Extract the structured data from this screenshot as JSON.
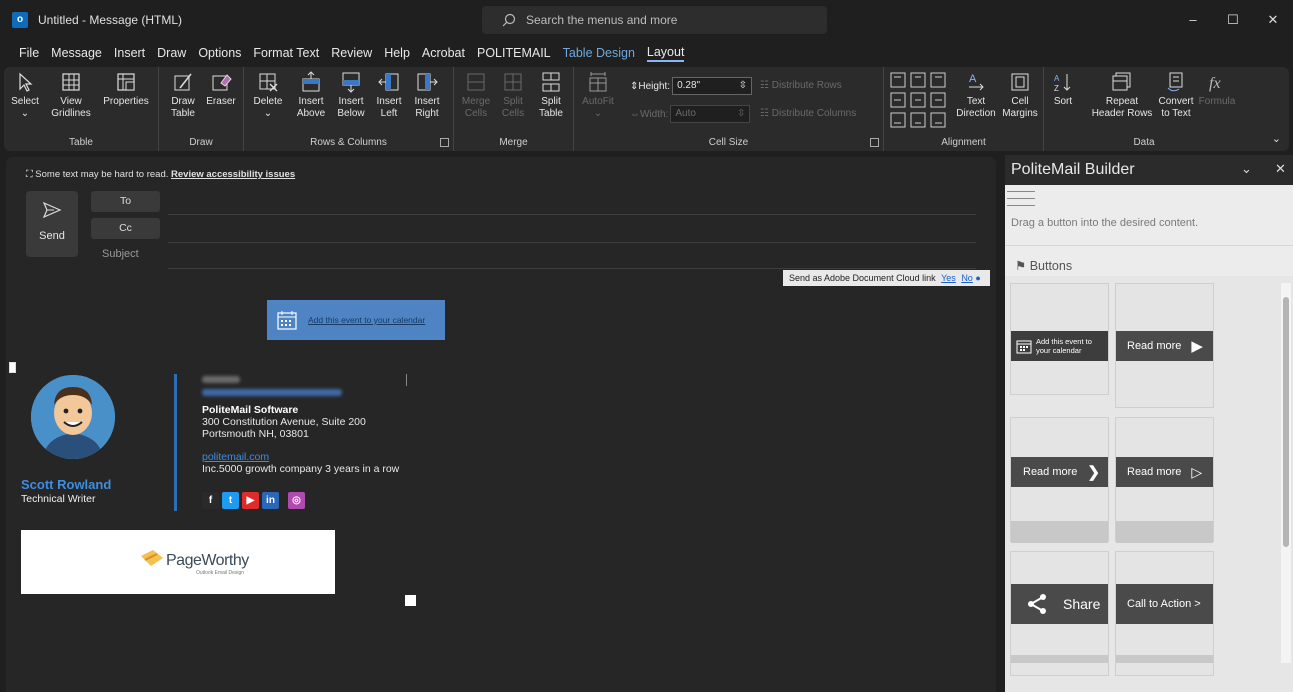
{
  "window": {
    "title": "Untitled  -  Message (HTML)",
    "search_placeholder": "Search the menus and more",
    "controls": [
      "–",
      "☐",
      "✕"
    ]
  },
  "menu": [
    "File",
    "Message",
    "Insert",
    "Draw",
    "Options",
    "Format Text",
    "Review",
    "Help",
    "Acrobat",
    "POLITEMAIL",
    "Table Design",
    "Layout"
  ],
  "ribbon": {
    "table": {
      "label": "Table",
      "select": "Select",
      "select_arrow": "⌄",
      "view_gridlines_1": "View",
      "view_gridlines_2": "Gridlines",
      "properties": "Properties"
    },
    "draw": {
      "label": "Draw",
      "draw_table_1": "Draw",
      "draw_table_2": "Table",
      "eraser": "Eraser"
    },
    "rows": {
      "label": "Rows & Columns",
      "delete": "Delete",
      "delete_arrow": "⌄",
      "insert_above_1": "Insert",
      "insert_above_2": "Above",
      "insert_below_1": "Insert",
      "insert_below_2": "Below",
      "insert_left_1": "Insert",
      "insert_left_2": "Left",
      "insert_right_1": "Insert",
      "insert_right_2": "Right"
    },
    "merge": {
      "label": "Merge",
      "merge_cells_1": "Merge",
      "merge_cells_2": "Cells",
      "split_cells_1": "Split",
      "split_cells_2": "Cells",
      "split_table_1": "Split",
      "split_table_2": "Table"
    },
    "cellsize": {
      "label": "Cell Size",
      "autofit": "AutoFit",
      "autofit_arrow": "⌄",
      "height_label": "Height:",
      "height_value": "0.28\"",
      "width_label": "Width:",
      "width_value": "Auto",
      "distribute_rows": "Distribute Rows",
      "distribute_columns": "Distribute Columns"
    },
    "alignment": {
      "label": "Alignment",
      "text_direction_1": "Text",
      "text_direction_2": "Direction",
      "cell_margins_1": "Cell",
      "cell_margins_2": "Margins"
    },
    "data": {
      "label": "Data",
      "sort": "Sort",
      "repeat_1": "Repeat",
      "repeat_2": "Header Rows",
      "convert_1": "Convert",
      "convert_2": "to Text",
      "formula": "Formula"
    },
    "collapse": "⌄"
  },
  "compose": {
    "accessibility_text": "Some text may be hard to read.",
    "accessibility_link": "Review accessibility issues",
    "send": "Send",
    "to": "To",
    "cc": "Cc",
    "subject": "Subject",
    "adobe_text": "Send as Adobe Document Cloud link",
    "adobe_yes": "Yes",
    "adobe_no": "No",
    "calendar_button": "Add this event to your calendar"
  },
  "signature": {
    "name": "Scott Rowland",
    "role": "Technical Writer",
    "company": "PoliteMail Software",
    "address_1": "300 Constitution Avenue, Suite 200",
    "address_2": "Portsmouth NH, 03801",
    "website": "politemail.com",
    "tagline": "Inc.5000 growth company 3 years in a row",
    "social": [
      "f",
      "t",
      "▶",
      "in",
      "◎"
    ],
    "banner_brand": "PageWorthy",
    "banner_sub": "Outlook Email Design"
  },
  "panel": {
    "title": "PoliteMail Builder",
    "hint": "Drag a button into the desired content.",
    "section": "Buttons",
    "tiles": [
      {
        "label": "Add this event to your calendar"
      },
      {
        "label": "Read more"
      },
      {
        "label": "Read more"
      },
      {
        "label": "Read more"
      },
      {
        "label": "Share"
      },
      {
        "label": "Call to Action  >"
      }
    ]
  }
}
